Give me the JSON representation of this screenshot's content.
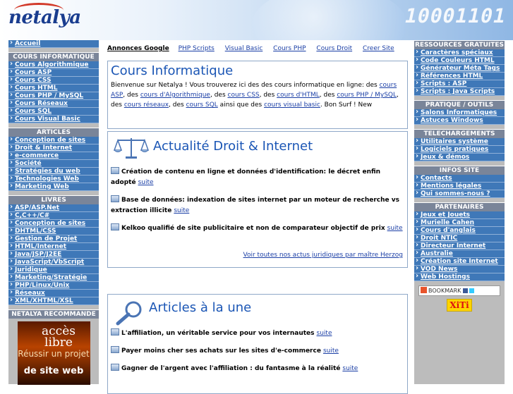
{
  "header": {
    "logo_text": "netalya",
    "binary_text": "10001101"
  },
  "left": {
    "home": "Accueil",
    "sections": [
      {
        "title": "COURS INFORMATIQUE",
        "items": [
          "Cours Algorithmique",
          "Cours ASP",
          "Cours CSS",
          "Cours HTML",
          "Cours PHP / MySQL",
          "Cours Réseaux",
          "Cours SQL",
          "Cours Visual Basic"
        ]
      },
      {
        "title": "ARTICLES",
        "items": [
          "Conception de sites",
          "Droit & Internet",
          "e-commerce",
          "Société",
          "Stratégies du web",
          "Technologies Web",
          "Marketing Web"
        ]
      },
      {
        "title": "LIVRES",
        "items": [
          "ASP/ASP.Net",
          "C,C++/C#",
          "Conception de sites",
          "DHTML/CSS",
          "Gestion de Projet",
          "HTML/Internet",
          "Java/JSP/J2EE",
          "JavaScript/VbScript",
          "Juridique",
          "Marketing/Stratégie",
          "PHP/Linux/Unix",
          "Réseaux",
          "XML/XHTML/XSL"
        ]
      }
    ],
    "recommande_title": "NETALYA RECOMMANDE",
    "banner": {
      "line1": "accès libre",
      "line2": "Réussir un projet",
      "line3": "de site web"
    }
  },
  "adbar": {
    "title": "Annonces Google",
    "links": [
      "PHP Scripts",
      "Visual Basic",
      "Cours PHP",
      "Cours Droit",
      "Creer Site"
    ]
  },
  "intro": {
    "title": "Cours Informatique",
    "text_1": "Bienvenue sur Netalya ! Vous trouverez ici des des cours informatique en ligne: des ",
    "l1": "cours ASP",
    "t2": ", des ",
    "l2": "cours d'Algorithmique",
    "t3": ", des ",
    "l3": "cours CSS",
    "t4": ", des ",
    "l4": "cours d'HTML",
    "t5": ", des ",
    "l5": "cours PHP / MySQL",
    "t6": ", des ",
    "l6": "cours réseaux",
    "t7": ", des ",
    "l7": "cours SQL",
    "t8": " ainsi que des ",
    "l8": "cours visual basic",
    "t9": ". Bon Surf ! New"
  },
  "droit": {
    "title": "Actualité Droit & Internet",
    "news": [
      {
        "text": "Création de contenu en ligne et données d'identification: le décret enfin adopté",
        "link": "suite"
      },
      {
        "text": "Base de données: indexation de sites internet par un moteur de recherche vs extraction illicite",
        "link": "suite"
      },
      {
        "text": "Kelkoo qualifié de site publicitaire et non de comparateur objectif de prix",
        "link": "suite"
      }
    ],
    "more": "Voir toutes nos actus juridiques par maître Herzog"
  },
  "articles": {
    "title": "Articles à la une",
    "news": [
      {
        "text": "L'affiliation, un véritable service pour vos internautes",
        "link": "suite"
      },
      {
        "text": "Payer moins cher ses achats sur les sites d'e-commerce",
        "link": "suite"
      },
      {
        "text": "Gagner de l'argent avec l'affiliation : du fantasme à la réalité",
        "link": "suite"
      }
    ]
  },
  "right": {
    "sections": [
      {
        "title": "RESSOURCES GRATUITES",
        "items": [
          "Caractères spéciaux",
          "Code Couleurs HTML",
          "Générateur Méta Tags",
          "Références HTML",
          "Scripts : ASP",
          "Scripts : Java Scripts"
        ]
      },
      {
        "title": "PRATIQUE / OUTILS",
        "items": [
          "Salons Informatiques",
          "Astuces Windows"
        ]
      },
      {
        "title": "TELECHARGEMENTS",
        "items": [
          "Utilitaires système",
          "Logiciels pratiques",
          "Jeux & démos"
        ]
      },
      {
        "title": "INFOS SITE",
        "items": [
          "Contacts",
          "Mentions légales",
          "Qui sommes-nous ?"
        ]
      },
      {
        "title": "PARTENAIRES",
        "items": [
          "Jeux et Jouets",
          "Murielle Cahen",
          "Cours d'anglais",
          "Droit NTIC",
          "Directeur Internet",
          "Australie",
          "Création site Internet",
          "VOD News",
          "Web Hostings"
        ]
      }
    ],
    "bookmark": "BOOKMARK",
    "xiti": "XiTi"
  },
  "colors": {
    "accent": "#3f78b8",
    "title_blue": "#1b56b5",
    "header_gray": "#7a8599"
  }
}
